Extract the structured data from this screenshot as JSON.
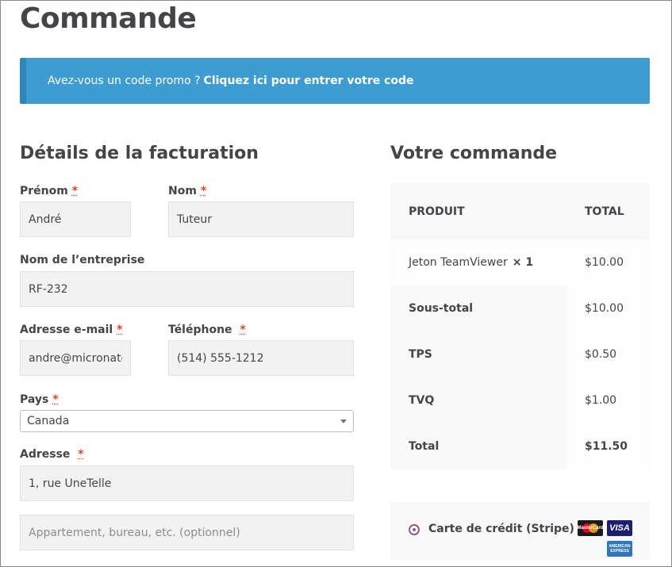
{
  "page": {
    "title": "Commande"
  },
  "promo": {
    "text": "Avez-vous un code promo ?",
    "link": "Cliquez ici pour entrer votre code"
  },
  "billing": {
    "title": "Détails de la facturation",
    "first_name": {
      "label": "Prénom",
      "value": "André"
    },
    "last_name": {
      "label": "Nom",
      "value": "Tuteur"
    },
    "company": {
      "label": "Nom de l’entreprise",
      "value": "RF-232"
    },
    "email": {
      "label": "Adresse e-mail",
      "value": "andre@micronato"
    },
    "phone": {
      "label": "Téléphone",
      "value": "(514) 555-1212"
    },
    "country": {
      "label": "Pays",
      "value": "Canada"
    },
    "address": {
      "label": "Adresse",
      "value": "1, rue UneTelle",
      "placeholder2": "Appartement, bureau, etc. (optionnel)"
    },
    "required_mark": "*"
  },
  "order": {
    "title": "Votre commande",
    "headers": {
      "product": "PRODUIT",
      "total": "TOTAL"
    },
    "items": [
      {
        "name": "Jeton TeamViewer",
        "qty": "× 1",
        "total": "$10.00"
      }
    ],
    "rows": [
      {
        "label": "Sous-total",
        "value": "$10.00"
      },
      {
        "label": "TPS",
        "value": "$0.50"
      },
      {
        "label": "TVQ",
        "value": "$1.00"
      },
      {
        "label": "Total",
        "value": "$11.50"
      }
    ]
  },
  "payment": {
    "method": "Carte de crédit (Stripe)",
    "cards": {
      "mastercard": "MasterCard",
      "visa": "VISA",
      "amex": "AMERICAN EXPRESS"
    }
  },
  "colors": {
    "promo_bg": "#3d9cd2",
    "required": "#e2401c",
    "radio": "#96588a"
  }
}
